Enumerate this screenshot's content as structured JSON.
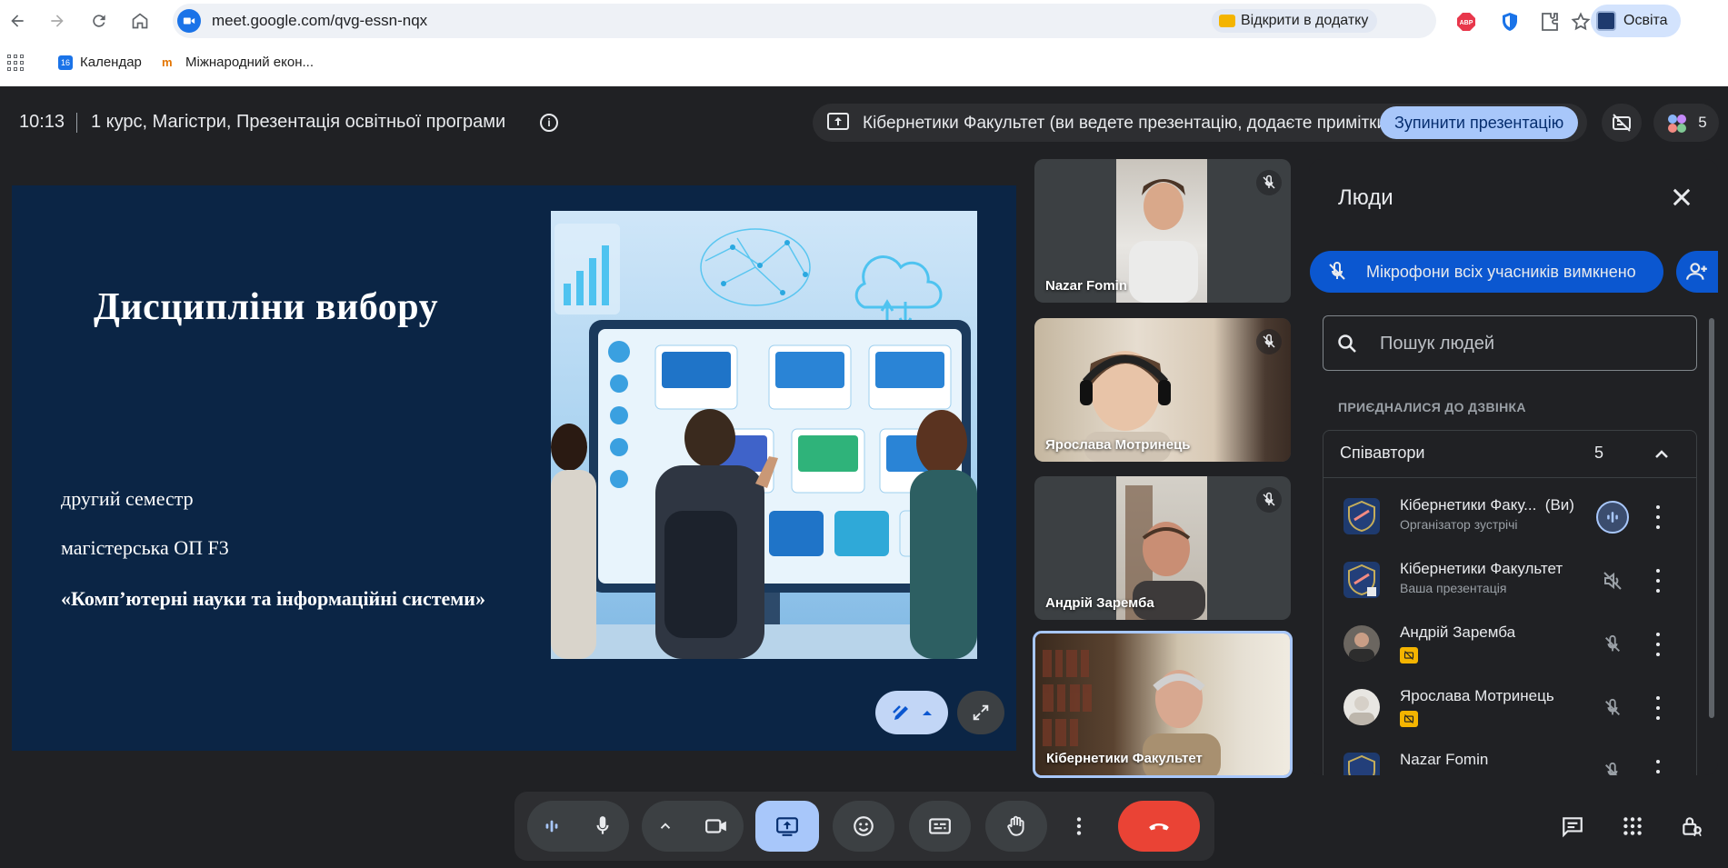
{
  "browser": {
    "url": "meet.google.com/qvg-essn-nqx",
    "open_in_app_label": "Відкрити в додатку",
    "profile_label": "Освіта",
    "extensions": [
      "abp-icon",
      "shield-icon",
      "puzzle-icon"
    ],
    "bookmarks": [
      {
        "label": "Календар",
        "icon": "calendar-icon",
        "icon_text": "16"
      },
      {
        "label": "Міжнародний екон...",
        "icon": "economy-icon",
        "icon_text": "m"
      }
    ]
  },
  "meeting": {
    "time": "10:13",
    "title": "1 курс, Магістри, Презентація освітньої програми",
    "presenting_label": "Кібернетики Факультет (ви ведете презентацію, додаєте примітки)",
    "stop_presenting_label": "Зупинити презентацію",
    "participant_count": "5"
  },
  "slide": {
    "title": "Дисципліни вибору",
    "lines": [
      "другий семестр",
      "магістерська ОП F3",
      "«Комп’ютерні науки та інформаційні системи»"
    ]
  },
  "tiles": [
    {
      "name": "Nazar Fomin",
      "muted": true
    },
    {
      "name": "Ярослава Мотринець",
      "muted": true
    },
    {
      "name": "Андрій Заремба",
      "muted": true
    },
    {
      "name": "Кібернетики Факультет",
      "muted": false,
      "active": true
    }
  ],
  "people_panel": {
    "title": "Люди",
    "mute_all_label": "Мікрофони всіх учасників вимкнено",
    "search_placeholder": "Пошук людей",
    "joined_label": "ПРИЄДНАЛИСЯ ДО ДЗВІНКА",
    "group_title": "Співавтори",
    "group_count": "5",
    "people": [
      {
        "name": "Кібернетики Факу...",
        "suffix": "(Ви)",
        "role": "Організатор зустрічі",
        "mic": "speaking"
      },
      {
        "name": "Кібернетики Факультет",
        "suffix": "",
        "role": "Ваша презентація",
        "mic": "muted-presentation"
      },
      {
        "name": "Андрій Заремба",
        "suffix": "",
        "role": "",
        "mic": "muted"
      },
      {
        "name": "Ярослава Мотринець",
        "suffix": "",
        "role": "",
        "mic": "muted"
      },
      {
        "name": "Nazar Fomin",
        "suffix": "",
        "role": "",
        "mic": "muted"
      }
    ]
  },
  "colors": {
    "meet_bg": "#202124",
    "accent": "#a8c7fa",
    "leave": "#ea4335",
    "slide_bg": "#0b2545"
  }
}
